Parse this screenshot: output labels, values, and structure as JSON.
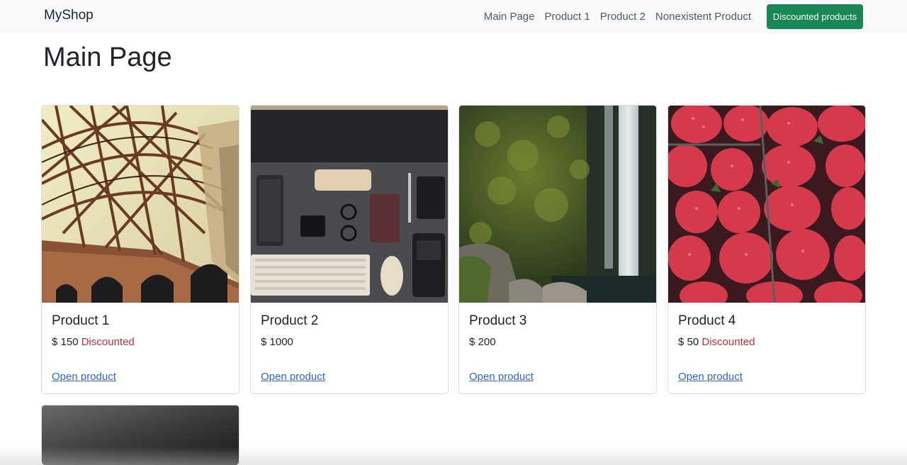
{
  "navbar": {
    "brand": "MyShop",
    "links": [
      "Main Page",
      "Product 1",
      "Product 2",
      "Nonexistent Product"
    ],
    "button_label": "Discounted products",
    "button_color": "#198754"
  },
  "page": {
    "title": "Main Page"
  },
  "products": [
    {
      "name": "Product 1",
      "price": "$ 150",
      "badge": "Discounted",
      "link": "Open product",
      "image": "steel-bridge-arches-photo"
    },
    {
      "name": "Product 2",
      "price": "$ 1000",
      "badge": "",
      "link": "Open product",
      "image": "desk-keyboard-flatlay-photo"
    },
    {
      "name": "Product 3",
      "price": "$ 200",
      "badge": "",
      "link": "Open product",
      "image": "waterfall-mossy-cliff-photo"
    },
    {
      "name": "Product 4",
      "price": "$ 50",
      "badge": "Discounted",
      "link": "Open product",
      "image": "strawberries-photo"
    },
    {
      "name": "",
      "price": "",
      "badge": "",
      "link": "",
      "image": "dark-grayscale-photo"
    }
  ],
  "colors": {
    "discount": "#b8323d",
    "link": "#2f66c6",
    "navbar_bg": "#f8f9fa"
  }
}
